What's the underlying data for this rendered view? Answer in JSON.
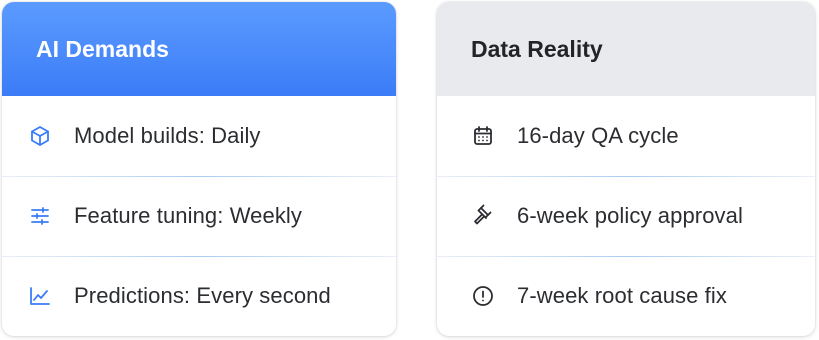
{
  "ai_demands": {
    "title": "AI Demands",
    "items": [
      {
        "icon": "cube-icon",
        "label": "Model builds: Daily"
      },
      {
        "icon": "sliders-icon",
        "label": "Feature tuning: Weekly"
      },
      {
        "icon": "trend-chart-icon",
        "label": "Predictions: Every second"
      }
    ]
  },
  "data_reality": {
    "title": "Data Reality",
    "items": [
      {
        "icon": "calendar-icon",
        "label": "16-day QA cycle"
      },
      {
        "icon": "gavel-icon",
        "label": "6-week policy approval"
      },
      {
        "icon": "alert-circle-icon",
        "label": "7-week root cause fix"
      }
    ]
  },
  "colors": {
    "accent": "#3b7cf7",
    "header_gray": "#e8eaed",
    "text": "#2b2d31"
  }
}
